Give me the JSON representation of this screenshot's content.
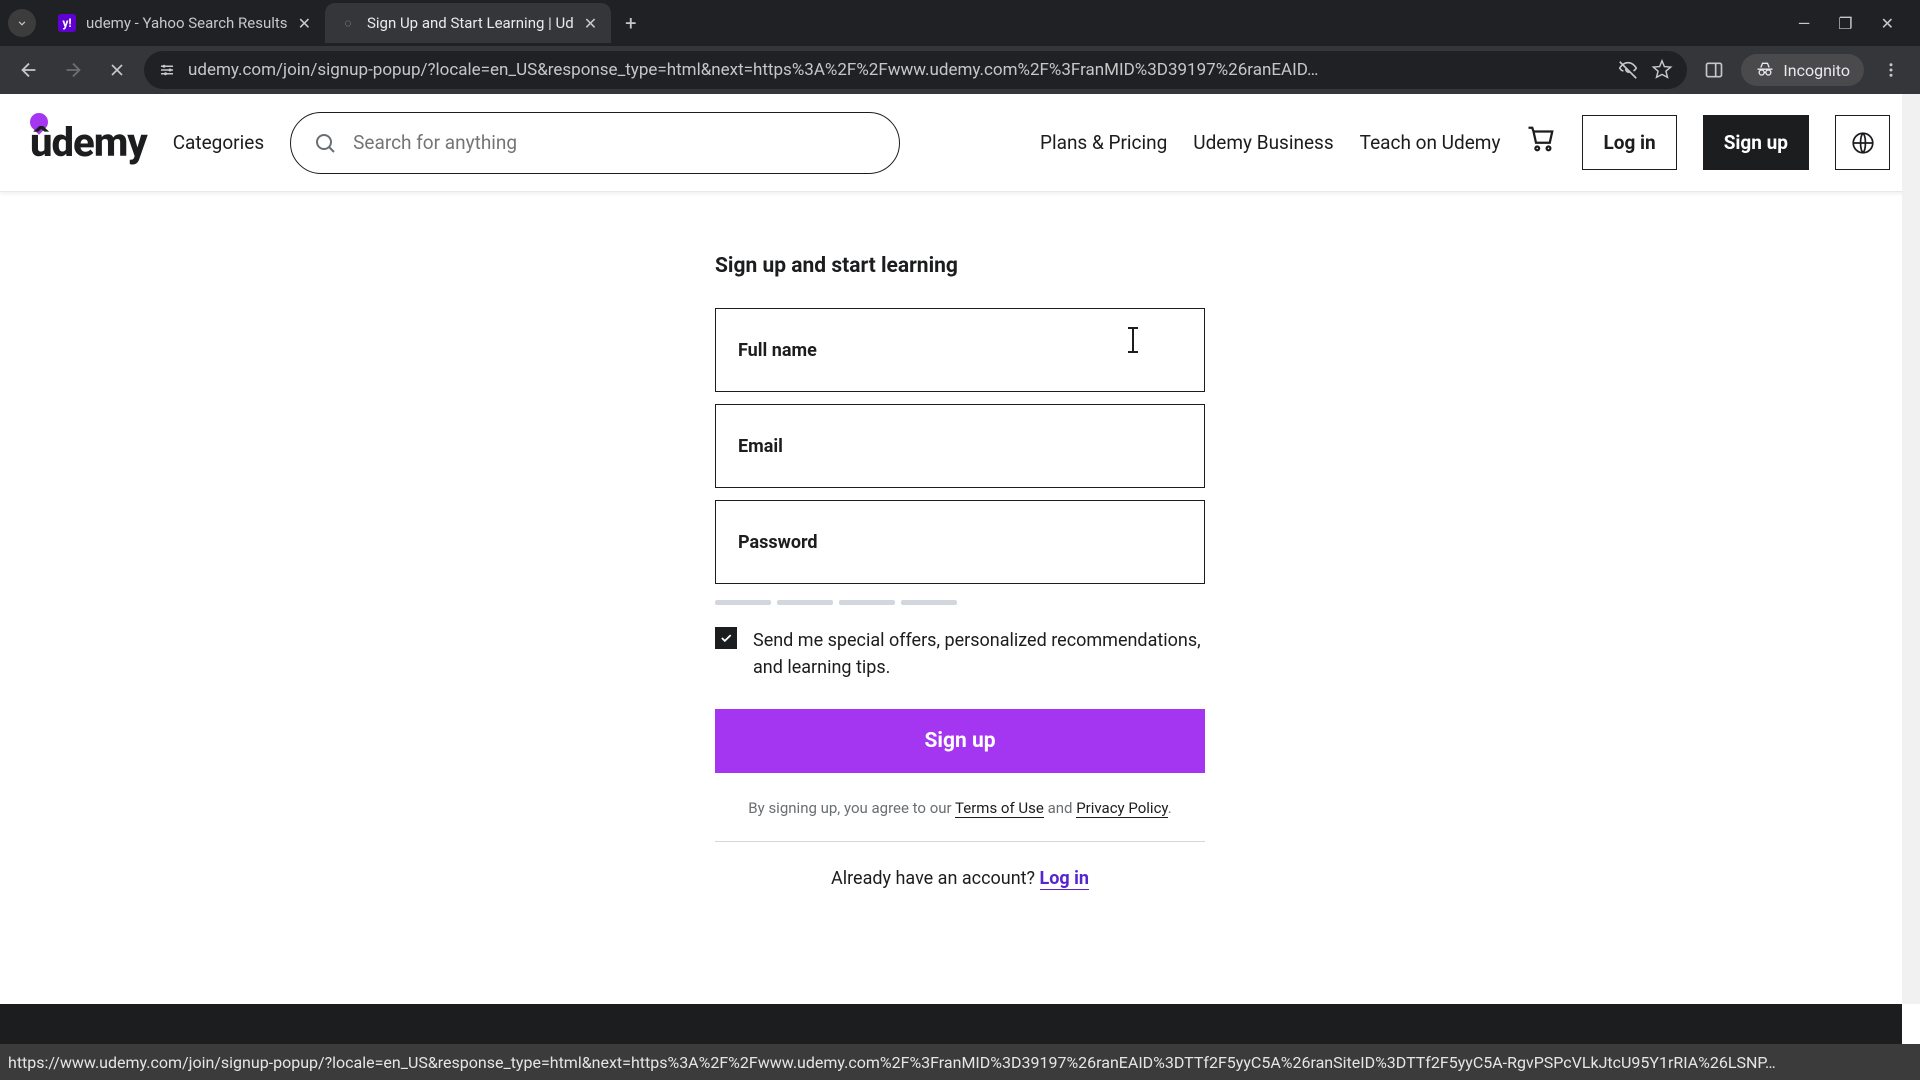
{
  "browser": {
    "tabs": [
      {
        "title": "udemy - Yahoo Search Results",
        "favicon": "y!"
      },
      {
        "title": "Sign Up and Start Learning | Ud",
        "favicon": "◌"
      }
    ],
    "url": "udemy.com/join/signup-popup/?locale=en_US&response_type=html&next=https%3A%2F%2Fwww.udemy.com%2F%3FranMID%3D39197%26ranEAID…",
    "incognito_label": "Incognito",
    "status_url": "https://www.udemy.com/join/signup-popup/?locale=en_US&response_type=html&next=https%3A%2F%2Fwww.udemy.com%2F%3FranMID%3D39197%26ranEAID%3DTTf2F5yyC5A%26ranSiteID%3DTTf2F5yyC5A-RgvPSPcVLkJtcU95Y1rRIA%26LSNP…"
  },
  "header": {
    "logo": "ûdemy",
    "categories": "Categories",
    "search_placeholder": "Search for anything",
    "plans": "Plans & Pricing",
    "business": "Udemy Business",
    "teach": "Teach on Udemy",
    "login": "Log in",
    "signup": "Sign up"
  },
  "signup": {
    "title": "Sign up and start learning",
    "fullname_label": "Full name",
    "email_label": "Email",
    "password_label": "Password",
    "offers_label": "Send me special offers, personalized recommendations, and learning tips.",
    "submit": "Sign up",
    "terms_prefix": "By signing up, you agree to our ",
    "terms_link": "Terms of Use",
    "terms_and": " and ",
    "privacy_link": "Privacy Policy",
    "terms_suffix": ".",
    "already": "Already have an account? ",
    "login_link": "Log in"
  }
}
